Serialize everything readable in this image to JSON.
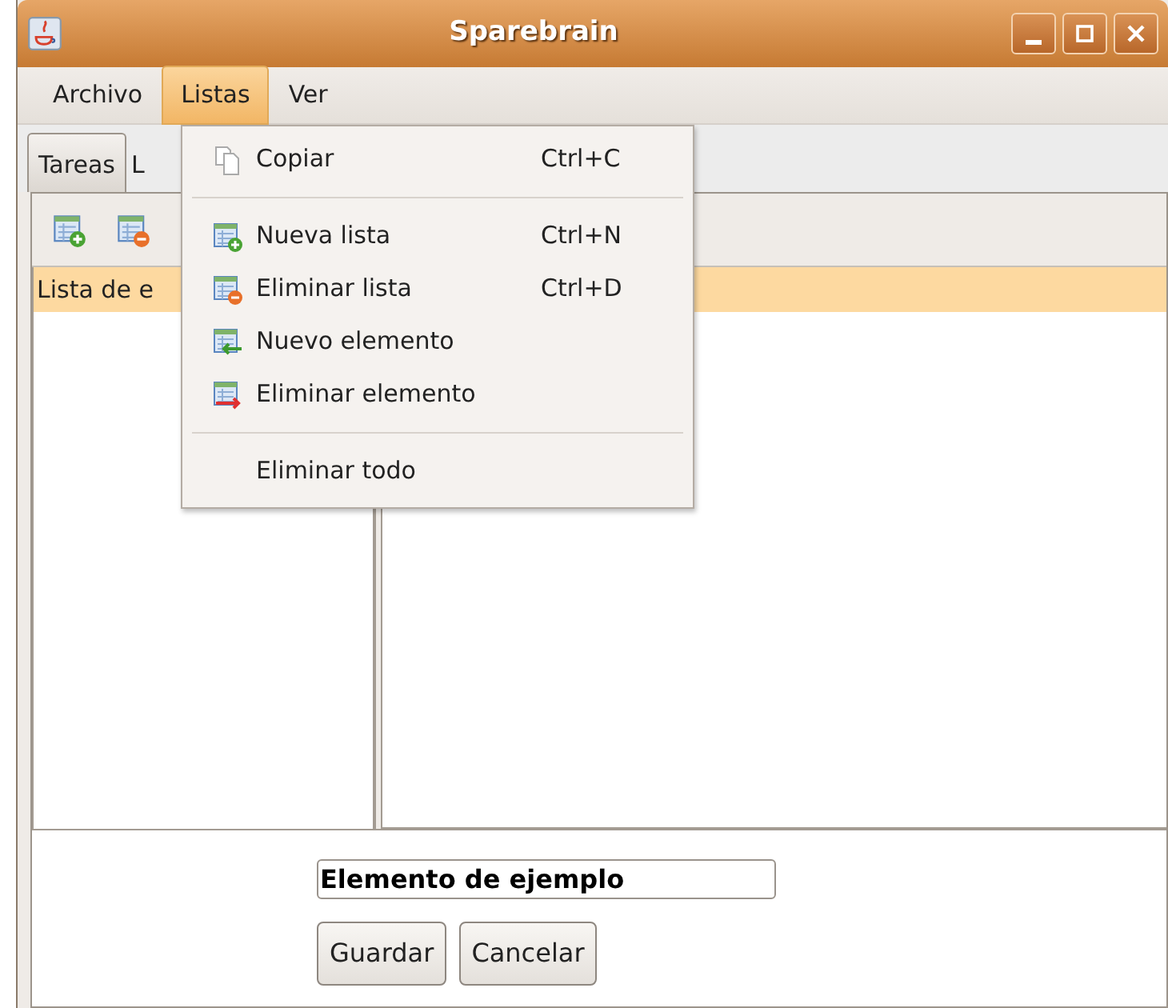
{
  "window": {
    "title": "Sparebrain"
  },
  "menubar": [
    {
      "label": "Archivo",
      "selected": false
    },
    {
      "label": "Listas",
      "selected": true
    },
    {
      "label": "Ver",
      "selected": false
    }
  ],
  "tabs": [
    {
      "label": "Tareas",
      "selected": true
    },
    {
      "label": "L",
      "selected": false
    }
  ],
  "toolbar": [
    {
      "kind": "add-list"
    },
    {
      "kind": "remove-list"
    }
  ],
  "list": {
    "rows": [
      {
        "label": "Lista de e",
        "selected": true
      }
    ]
  },
  "menu": {
    "items": [
      {
        "kind": "copy",
        "label": "Copiar",
        "shortcut": "Ctrl+C"
      },
      {
        "kind": "separator"
      },
      {
        "kind": "add-list",
        "label": "Nueva lista",
        "shortcut": "Ctrl+N"
      },
      {
        "kind": "remove-list",
        "label": "Eliminar lista",
        "shortcut": "Ctrl+D"
      },
      {
        "kind": "add-element",
        "label": "Nuevo elemento"
      },
      {
        "kind": "remove-element",
        "label": "Eliminar elemento"
      },
      {
        "kind": "separator"
      },
      {
        "kind": "plain",
        "label": "Eliminar todo"
      }
    ]
  },
  "editor": {
    "value": "Elemento de ejemplo",
    "buttons": [
      "Guardar",
      "Cancelar"
    ]
  }
}
